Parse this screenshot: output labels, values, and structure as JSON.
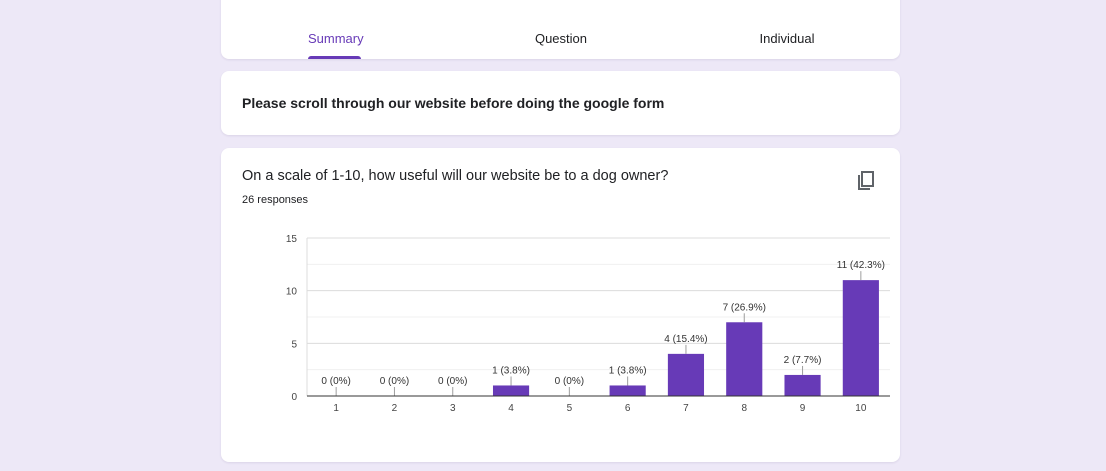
{
  "tabs": [
    {
      "label": "Summary",
      "active": true
    },
    {
      "label": "Question",
      "active": false
    },
    {
      "label": "Individual",
      "active": false
    }
  ],
  "description": {
    "text": "Please scroll through our website before doing the google form"
  },
  "question": {
    "title": "On a scale of 1-10, how useful will our website be to a dog owner?",
    "response_count": "26 responses",
    "copy_icon": "copy-icon"
  },
  "colors": {
    "accent": "#673ab7",
    "bar": "#673ab7",
    "background": "#ede8f7"
  },
  "chart_data": {
    "type": "bar",
    "categories": [
      "1",
      "2",
      "3",
      "4",
      "5",
      "6",
      "7",
      "8",
      "9",
      "10"
    ],
    "values": [
      0,
      0,
      0,
      1,
      0,
      1,
      4,
      7,
      2,
      11
    ],
    "data_labels": [
      "0 (0%)",
      "0 (0%)",
      "0 (0%)",
      "1 (3.8%)",
      "0 (0%)",
      "1 (3.8%)",
      "4 (15.4%)",
      "7 (26.9%)",
      "2 (7.7%)",
      "11 (42.3%)"
    ],
    "yticks": [
      0,
      5,
      10,
      15
    ],
    "ylim": [
      0,
      15
    ],
    "grid": true
  }
}
